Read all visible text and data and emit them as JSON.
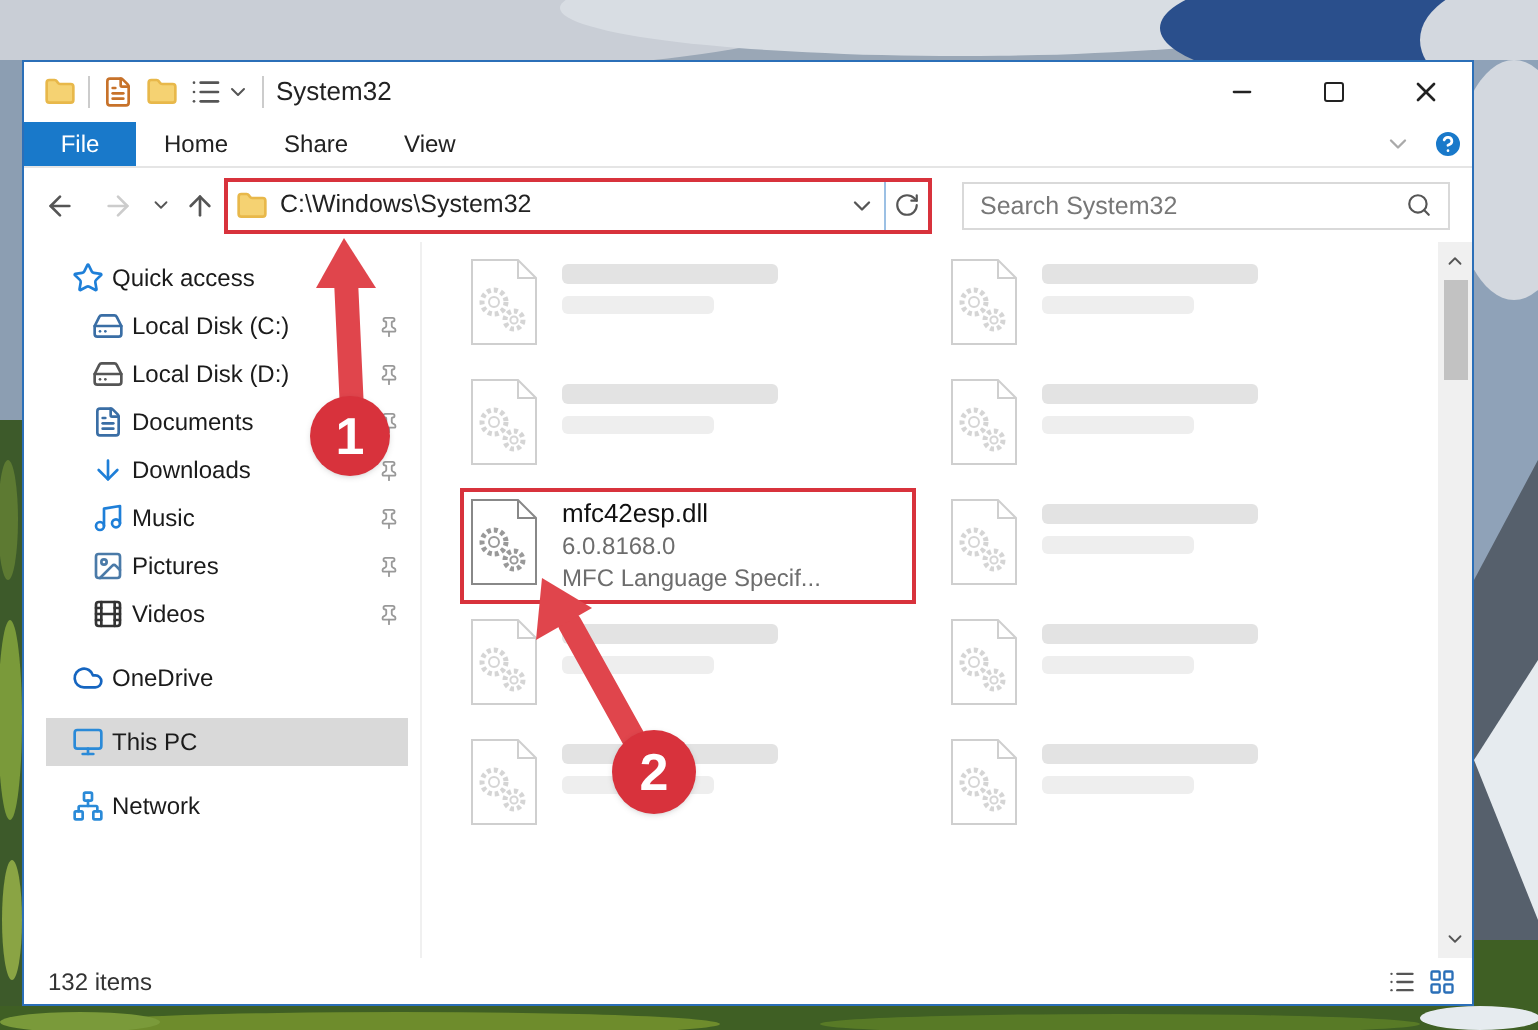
{
  "window": {
    "title": "System32"
  },
  "ribbon": {
    "tabs": [
      {
        "label": "File",
        "kind": "file"
      },
      {
        "label": "Home",
        "kind": "tab"
      },
      {
        "label": "Share",
        "kind": "tab"
      },
      {
        "label": "View",
        "kind": "tab"
      }
    ]
  },
  "navigation": {
    "forward": {
      "disabled": true
    }
  },
  "address_bar": {
    "path": "C:\\Windows\\System32",
    "highlighted": true
  },
  "search": {
    "placeholder": "Search System32"
  },
  "sidebar": {
    "items": [
      {
        "label": "Quick access",
        "selected": false,
        "children": [
          {
            "label": "Local Disk (C:)",
            "pinned": true,
            "selected": false
          },
          {
            "label": "Local Disk (D:)",
            "pinned": true,
            "selected": false
          },
          {
            "label": "Documents",
            "pinned": true,
            "selected": false
          },
          {
            "label": "Downloads",
            "pinned": true,
            "selected": false
          },
          {
            "label": "Music",
            "pinned": true,
            "selected": false
          },
          {
            "label": "Pictures",
            "pinned": true,
            "selected": false
          },
          {
            "label": "Videos",
            "pinned": true,
            "selected": false
          }
        ]
      },
      {
        "label": "OneDrive",
        "selected": false
      },
      {
        "label": "This PC",
        "selected": true
      },
      {
        "label": "Network",
        "selected": false
      }
    ]
  },
  "files": [
    {
      "faded": true,
      "highlighted": false
    },
    {
      "faded": true,
      "highlighted": false
    },
    {
      "faded": true,
      "highlighted": false
    },
    {
      "faded": true,
      "highlighted": false
    },
    {
      "name": "mfc42esp.dll",
      "lines": [
        "6.0.8168.0",
        "MFC Language Specif..."
      ],
      "faded": false,
      "highlighted": true
    },
    {
      "faded": true,
      "highlighted": false
    },
    {
      "faded": true,
      "highlighted": false
    },
    {
      "faded": true,
      "highlighted": false
    },
    {
      "faded": true,
      "highlighted": false
    },
    {
      "faded": true,
      "highlighted": false
    }
  ],
  "status_bar": {
    "item_count": "132 items"
  },
  "annotations": [
    {
      "label": "1"
    },
    {
      "label": "2"
    }
  ]
}
